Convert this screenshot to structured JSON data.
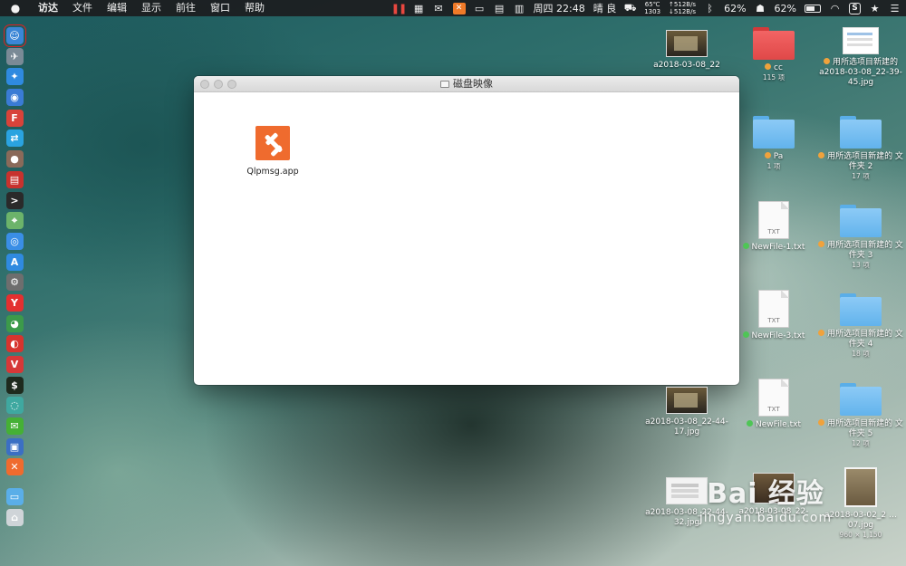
{
  "menubar": {
    "app_name": "访达",
    "items": [
      "文件",
      "编辑",
      "显示",
      "前往",
      "窗口",
      "帮助"
    ],
    "status": {
      "temp": "65℃",
      "fan": "1303",
      "net_up": "↑512B/s",
      "net_down": "↓512B/s",
      "datetime": "周四 22:48",
      "weather": "晴 良",
      "battery_1": "62%",
      "battery_2": "62%"
    }
  },
  "dock": {
    "icons": [
      {
        "name": "finder-icon",
        "color": "#3b86d6",
        "glyph": "☺"
      },
      {
        "name": "launchpad-icon",
        "color": "#7a8a96",
        "glyph": "✈"
      },
      {
        "name": "safari-icon",
        "color": "#2f8ae0",
        "glyph": "✦"
      },
      {
        "name": "contacts-icon",
        "color": "#3a7bd5",
        "glyph": "◉"
      },
      {
        "name": "app-red-icon",
        "color": "#d8433a",
        "glyph": "F"
      },
      {
        "name": "teamviewer-icon",
        "color": "#2aa3e0",
        "glyph": "⇄"
      },
      {
        "name": "photo-app-icon",
        "color": "#8a6a5a",
        "glyph": "●"
      },
      {
        "name": "netease-music-icon",
        "color": "#c8322e",
        "glyph": "▤"
      },
      {
        "name": "terminal-icon",
        "color": "#2a2a2a",
        "glyph": ">"
      },
      {
        "name": "maps-icon",
        "color": "#6cb36a",
        "glyph": "⌖"
      },
      {
        "name": "siri-icon",
        "color": "#3a8ee6",
        "glyph": "◎"
      },
      {
        "name": "app-store-icon",
        "color": "#2f8ae0",
        "glyph": "A"
      },
      {
        "name": "system-prefs-icon",
        "color": "#6e6e6e",
        "glyph": "⚙"
      },
      {
        "name": "yandex-icon",
        "color": "#e33030",
        "glyph": "Y"
      },
      {
        "name": "chrome-icon",
        "color": "#3c9a4a",
        "glyph": "◕"
      },
      {
        "name": "netease-icon",
        "color": "#d7342e",
        "glyph": "◐"
      },
      {
        "name": "vivaldi-icon",
        "color": "#d63838",
        "glyph": "V"
      },
      {
        "name": "iterm-icon",
        "color": "#1e2a1e",
        "glyph": "$"
      },
      {
        "name": "share-app-icon",
        "color": "#3fa8a0",
        "glyph": "◌"
      },
      {
        "name": "wechat-icon",
        "color": "#45b035",
        "glyph": "✉"
      },
      {
        "name": "screen-app-icon",
        "color": "#3b6fc4",
        "glyph": "▣"
      },
      {
        "name": "qipmsg-dock-icon",
        "color": "#ef6b2e",
        "glyph": "✕"
      }
    ],
    "bottom_icons": [
      {
        "name": "downloads-folder-icon",
        "color": "#5aaee8",
        "glyph": "▭"
      },
      {
        "name": "trash-icon",
        "color": "#cfd4d8",
        "glyph": "⌂"
      }
    ]
  },
  "window": {
    "title": "磁盘映像",
    "items": [
      {
        "label": "Qlpmsg.app"
      }
    ]
  },
  "desktop": {
    "c1_top_label": "a2018-03-08_22",
    "c1_img2_label": "a2018-03-08_22-44-17.jpg",
    "c1_img3_label": "a2018-03-08_22-44-32.jpg",
    "cc_label": "cc",
    "cc_sub": "115 项",
    "pa_label": "Pa",
    "pa_sub": "1 项",
    "newfile1_label": "NewFile-1.txt",
    "newfile3_label": "NewFile-3.txt",
    "newfile_label": "NewFile.txt",
    "txt_ext": "TXT",
    "c2_img_label": "a2018-03-08_22-",
    "r1_label": "用所选项目新建的 a2018-03-08_22-39-45.jpg",
    "r2_label": "用所选项目新建的 文件夹 2",
    "r2_sub": "17 项",
    "r3_label": "用所选项目新建的 文件夹 3",
    "r3_sub": "13 项",
    "r4_label": "用所选项目新建的 文件夹 4",
    "r4_sub": "18 项",
    "r5_label": "用所选项目新建的 文件夹 5",
    "r5_sub": "12 项",
    "r6_label": "a2018-03-02_2 …07.jpg",
    "r6_sub": "960 × 1,150"
  },
  "watermark": {
    "main": "Bai 经验",
    "sub": "jingyan.baidu.com"
  }
}
